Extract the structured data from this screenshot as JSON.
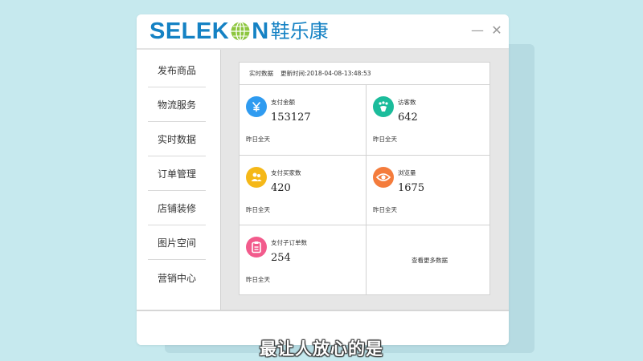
{
  "brand": {
    "logo_text_left": "SELEK",
    "logo_text_right": "N",
    "logo_chinese": "鞋乐康",
    "primary_color": "#1582c4",
    "accent_color": "#8dc63f"
  },
  "window_controls": {
    "minimize": "—",
    "close": "✕"
  },
  "sidebar": {
    "items": [
      {
        "label": "发布商品"
      },
      {
        "label": "物流服务"
      },
      {
        "label": "实时数据"
      },
      {
        "label": "订单管理"
      },
      {
        "label": "店铺装修"
      },
      {
        "label": "图片空间"
      },
      {
        "label": "营销中心"
      }
    ]
  },
  "panel": {
    "header_title": "实时数据",
    "header_updated": "更新时间:2018-04-08-13:48:53",
    "cells": [
      {
        "label": "支付金额",
        "value": "153127",
        "sub": "昨日全天",
        "icon": "yuan-icon",
        "color": "#2f9bf0"
      },
      {
        "label": "访客数",
        "value": "642",
        "sub": "昨日全天",
        "icon": "footprint-icon",
        "color": "#1bbc9b"
      },
      {
        "label": "支付买家数",
        "value": "420",
        "sub": "昨日全天",
        "icon": "users-icon",
        "color": "#f5b818"
      },
      {
        "label": "浏览量",
        "value": "1675",
        "sub": "昨日全天",
        "icon": "eye-icon",
        "color": "#f47c3c"
      },
      {
        "label": "支付子订单数",
        "value": "254",
        "sub": "昨日全天",
        "icon": "clipboard-icon",
        "color": "#f25b8c"
      }
    ],
    "more_link": "查看更多数据"
  },
  "subtitle": "最让人放心的是"
}
